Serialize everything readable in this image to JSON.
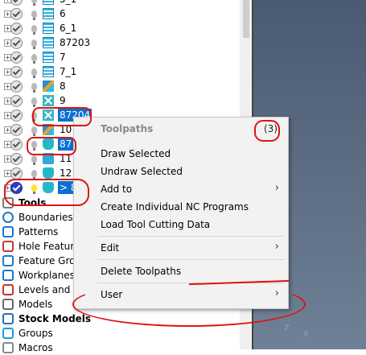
{
  "tree": {
    "toolpaths": [
      {
        "label": "5_1",
        "checked": true,
        "icon": "toolpath-lines-icon",
        "selected": false
      },
      {
        "label": "6",
        "checked": true,
        "icon": "toolpath-lines-icon",
        "selected": false
      },
      {
        "label": "6_1",
        "checked": true,
        "icon": "toolpath-lines-icon",
        "selected": false
      },
      {
        "label": "87203",
        "checked": true,
        "icon": "toolpath-lines-icon",
        "selected": false
      },
      {
        "label": "7",
        "checked": true,
        "icon": "toolpath-lines-icon",
        "selected": false
      },
      {
        "label": "7_1",
        "checked": true,
        "icon": "toolpath-lines-icon",
        "selected": false
      },
      {
        "label": "8",
        "checked": true,
        "icon": "toolpath-multi-icon",
        "selected": false
      },
      {
        "label": "9",
        "checked": true,
        "icon": "toolpath-cross-icon",
        "selected": false
      },
      {
        "label": "87204",
        "checked": true,
        "icon": "toolpath-cross-icon",
        "selected": true
      },
      {
        "label": "10",
        "checked": true,
        "icon": "toolpath-multi-icon",
        "selected": false
      },
      {
        "label": "87",
        "checked": true,
        "icon": "toolpath-tool-icon",
        "selected": true
      },
      {
        "label": "11",
        "checked": true,
        "icon": "toolpath-vtool-icon",
        "selected": false
      },
      {
        "label": "12",
        "checked": true,
        "icon": "toolpath-tool-icon",
        "selected": false
      },
      {
        "label": "> 8",
        "checked": true,
        "icon": "toolpath-tool-icon",
        "selected": true,
        "active": true
      }
    ],
    "nodes": [
      {
        "label": "Tools",
        "bold": true,
        "icon": "tools-icon"
      },
      {
        "label": "Boundaries",
        "bold": false,
        "icon": "boundaries-icon"
      },
      {
        "label": "Patterns",
        "bold": false,
        "icon": "patterns-icon"
      },
      {
        "label": "Hole Feature",
        "bold": false,
        "icon": "hole-feature-icon"
      },
      {
        "label": "Feature Grou",
        "bold": false,
        "icon": "feature-group-icon"
      },
      {
        "label": "Workplanes",
        "bold": false,
        "icon": "workplanes-icon"
      },
      {
        "label": "Levels and Se",
        "bold": false,
        "icon": "levels-icon"
      },
      {
        "label": "Models",
        "bold": false,
        "icon": "models-icon"
      },
      {
        "label": "Stock Models",
        "bold": true,
        "icon": "stock-models-icon"
      },
      {
        "label": "Groups",
        "bold": false,
        "icon": "groups-icon"
      },
      {
        "label": "Macros",
        "bold": false,
        "icon": "macros-icon"
      }
    ]
  },
  "context_menu": {
    "title": "Toolpaths",
    "count": "(3)",
    "items": {
      "draw_selected": "Draw Selected",
      "undraw_selected": "Undraw Selected",
      "add_to": "Add to",
      "create_nc": "Create Individual NC Programs",
      "load_tool_data": "Load Tool Cutting Data",
      "edit": "Edit",
      "delete_toolpaths": "Delete Toolpaths",
      "user": "User"
    },
    "submenu_arrow": "›"
  },
  "viewport": {
    "axis_z": "Z",
    "axis_x": "X"
  },
  "colors": {
    "selection": "#0a70d3",
    "annotation_red": "#e01212",
    "menu_bg": "#f2f2f2"
  }
}
